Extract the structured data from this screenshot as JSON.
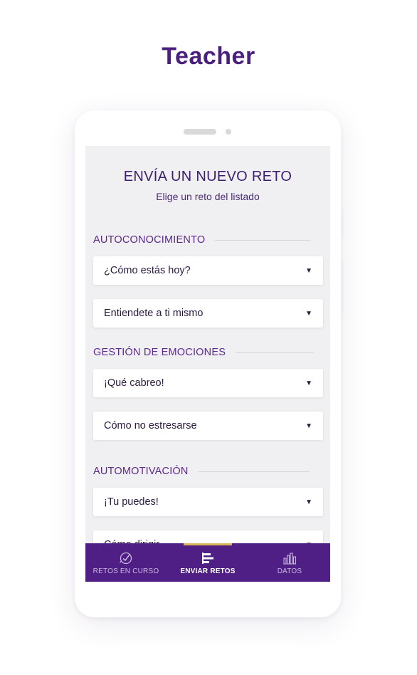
{
  "page": {
    "title": "Teacher"
  },
  "screen": {
    "title": "ENVÍA UN NUEVO RETO",
    "subtitle": "Elige un reto del listado"
  },
  "sections": [
    {
      "label": "AUTOCONOCIMIENTO",
      "items": [
        {
          "label": "¿Cómo estás hoy?"
        },
        {
          "label": "Entiendete a ti mismo"
        }
      ]
    },
    {
      "label": "GESTIÓN DE EMOCIONES",
      "items": [
        {
          "label": "¡Qué cabreo!"
        },
        {
          "label": "Cómo no estresarse"
        }
      ]
    },
    {
      "label": "AUTOMOTIVACIÓN",
      "items": [
        {
          "label": "¡Tu puedes!"
        },
        {
          "label": "Cómo dirigir..."
        }
      ]
    }
  ],
  "tabbar": {
    "tabs": [
      {
        "label": "RETOS EN CURSO",
        "icon": "challenges-check-icon",
        "active": false
      },
      {
        "label": "ENVIAR RETOS",
        "icon": "send-list-icon",
        "active": true
      },
      {
        "label": "DATOS",
        "icon": "bar-chart-icon",
        "active": false
      }
    ]
  },
  "colors": {
    "brand_purple": "#4f1f85",
    "accent_gold": "#d9b65a",
    "title_purple": "#4a1f80"
  }
}
